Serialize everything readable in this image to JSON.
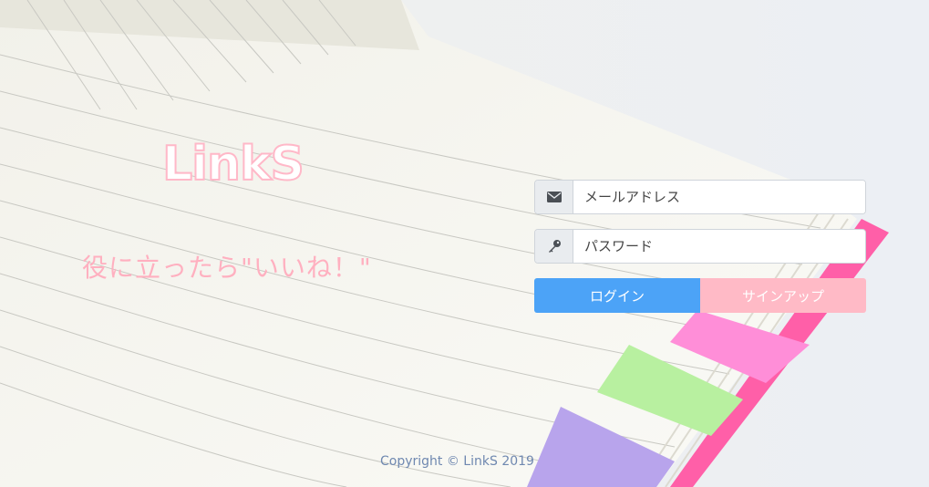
{
  "brand": {
    "logo": "LinkS",
    "tagline": "役に立ったら\"いいね！\""
  },
  "login_form": {
    "email": {
      "placeholder": "メールアドレス",
      "icon": "envelope-icon"
    },
    "password": {
      "placeholder": "パスワード",
      "icon": "key-icon"
    },
    "login_label": "ログイン",
    "signup_label": "サインアップ"
  },
  "footer": {
    "copyright": "Copyright © LinkS 2019"
  },
  "colors": {
    "login": "#4ca3f7",
    "signup": "#ffbac6",
    "logo_outline": "#ffb8c8",
    "tagline": "#ffb0c0",
    "copyright": "#6f88b0"
  }
}
